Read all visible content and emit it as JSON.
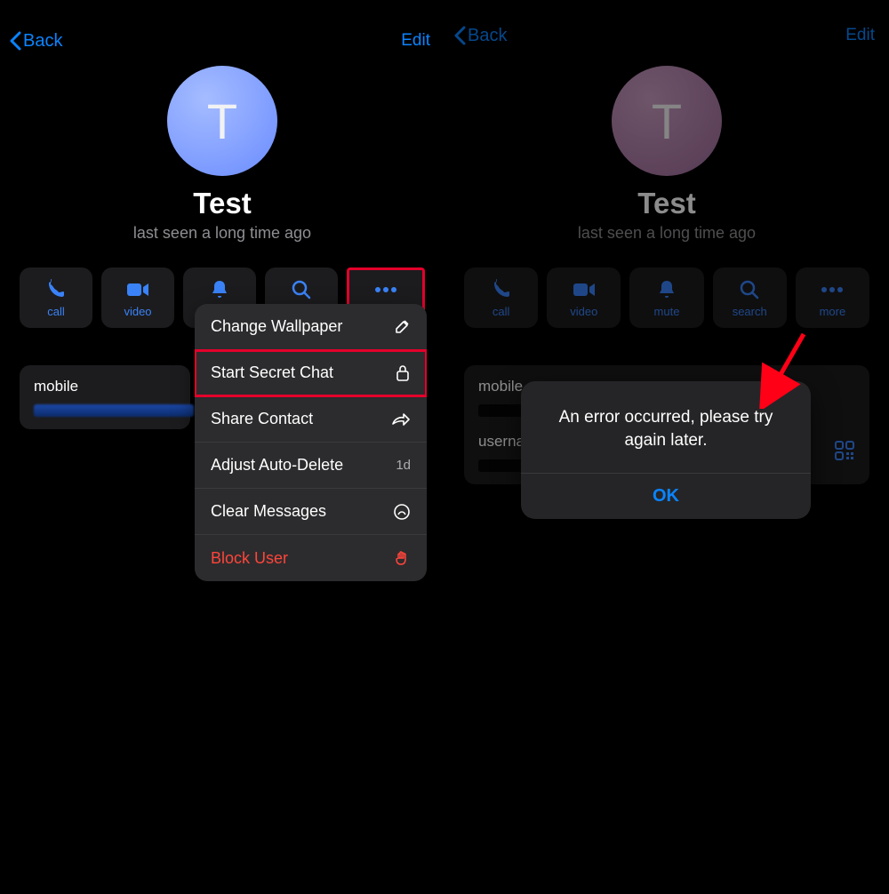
{
  "nav": {
    "back": "Back",
    "edit": "Edit"
  },
  "contact": {
    "avatar_initial": "T",
    "name": "Test",
    "status": "last seen a long time ago"
  },
  "actions": {
    "call": "call",
    "video": "video",
    "mute": "mute",
    "search": "search",
    "more": "more"
  },
  "info": {
    "mobile_label": "mobile",
    "username_label": "userna"
  },
  "more_menu": {
    "change_wallpaper": "Change Wallpaper",
    "start_secret_chat": "Start Secret Chat",
    "share_contact": "Share Contact",
    "adjust_auto_delete": "Adjust Auto-Delete",
    "auto_delete_value": "1d",
    "clear_messages": "Clear Messages",
    "block_user": "Block User"
  },
  "alert": {
    "message": "An error occurred, please try again later.",
    "ok": "OK"
  }
}
